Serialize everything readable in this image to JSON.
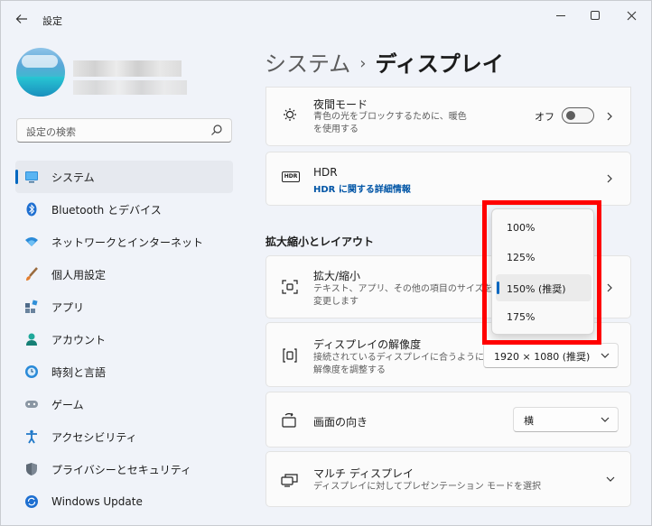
{
  "window": {
    "title": "設定"
  },
  "sidebar": {
    "search_placeholder": "設定の検索",
    "items": [
      {
        "label": "システム",
        "icon": "monitor-icon"
      },
      {
        "label": "Bluetooth とデバイス",
        "icon": "bluetooth-icon"
      },
      {
        "label": "ネットワークとインターネット",
        "icon": "wifi-icon"
      },
      {
        "label": "個人用設定",
        "icon": "brush-icon"
      },
      {
        "label": "アプリ",
        "icon": "apps-icon"
      },
      {
        "label": "アカウント",
        "icon": "person-icon"
      },
      {
        "label": "時刻と言語",
        "icon": "clock-globe-icon"
      },
      {
        "label": "ゲーム",
        "icon": "gamepad-icon"
      },
      {
        "label": "アクセシビリティ",
        "icon": "accessibility-icon"
      },
      {
        "label": "プライバシーとセキュリティ",
        "icon": "shield-icon"
      },
      {
        "label": "Windows Update",
        "icon": "update-icon"
      }
    ]
  },
  "breadcrumb": {
    "parent": "システム",
    "separator": "›",
    "current": "ディスプレイ"
  },
  "night_light": {
    "title": "夜間モード",
    "desc_line1": "青色の光をブロックするために、暖色",
    "desc_line2": "を使用する",
    "toggle_label": "オフ"
  },
  "hdr": {
    "icon_text": "HDR",
    "title": "HDR",
    "link": "HDR に関する詳細情報"
  },
  "section_title": "拡大縮小とレイアウト",
  "scale": {
    "title": "拡大/縮小",
    "desc_line1": "テキスト、アプリ、その他の項目のサイズを",
    "desc_line2": "変更します"
  },
  "resolution": {
    "title": "ディスプレイの解像度",
    "desc_line1": "接続されているディスプレイに合うように",
    "desc_line2": "解像度を調整する",
    "value": "1920 × 1080 (推奨)"
  },
  "orientation": {
    "title": "画面の向き",
    "value": "横"
  },
  "multi_display": {
    "title": "マルチ ディスプレイ",
    "desc": "ディスプレイに対してプレゼンテーション モードを選択"
  },
  "scale_dropdown": {
    "options": [
      "100%",
      "125%",
      "150% (推奨)",
      "175%"
    ],
    "selected_index": 2
  },
  "colors": {
    "accent": "#0067c0",
    "highlight_box": "#ff0000"
  }
}
